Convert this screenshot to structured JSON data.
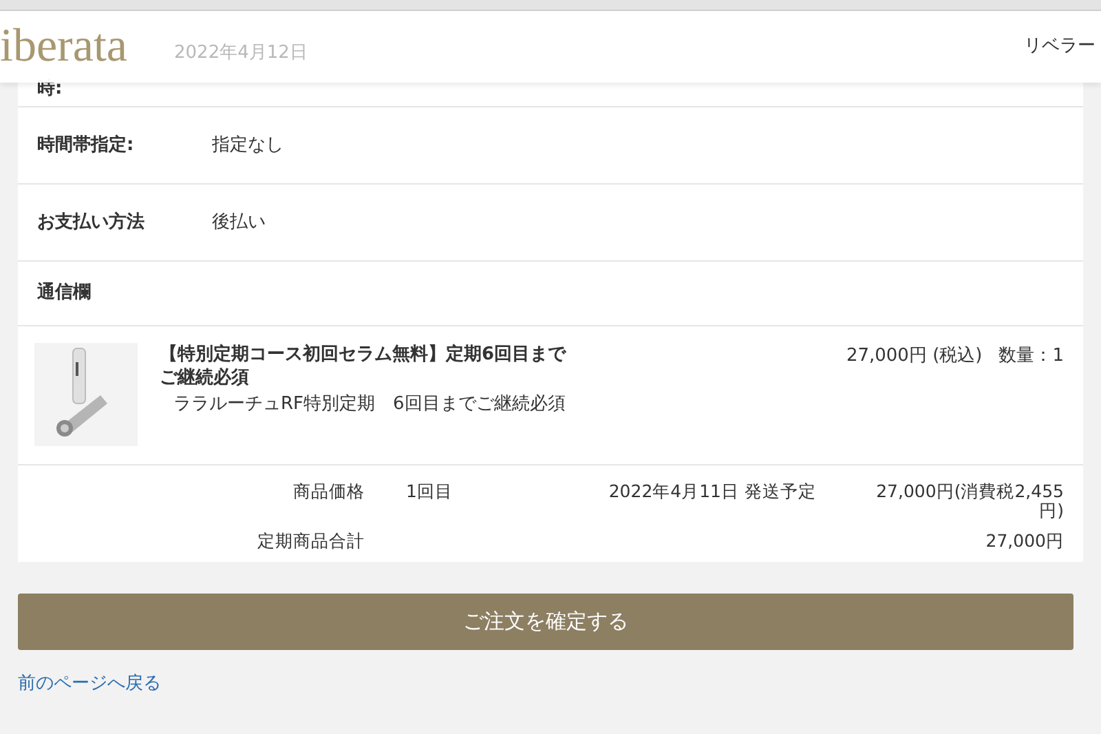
{
  "header": {
    "logo": "iberata",
    "faded_date": "2022年4月12日",
    "site_name": "リベラー"
  },
  "rows": [
    {
      "label": "時:",
      "value": ""
    },
    {
      "label": "時間帯指定:",
      "value": "指定なし"
    },
    {
      "label": "お支払い方法",
      "value": "後払い"
    },
    {
      "label": "通信欄",
      "value": ""
    }
  ],
  "product": {
    "title": "【特別定期コース初回セラム無料】定期6回目までご継続必須",
    "subtitle": "ララルーチュRF特別定期　6回目までご継続必須",
    "price": "27,000円 (税込)",
    "quantity": "数量：1"
  },
  "summary": {
    "price_label": "商品価格",
    "round": "1回目",
    "ship_date": "2022年4月11日 発送予定",
    "price": "27,000円(消費税2,455円)",
    "total_label": "定期商品合計",
    "total": "27,000円"
  },
  "confirm_button": "ご注文を確定する",
  "back_link": "前のページへ戻る"
}
